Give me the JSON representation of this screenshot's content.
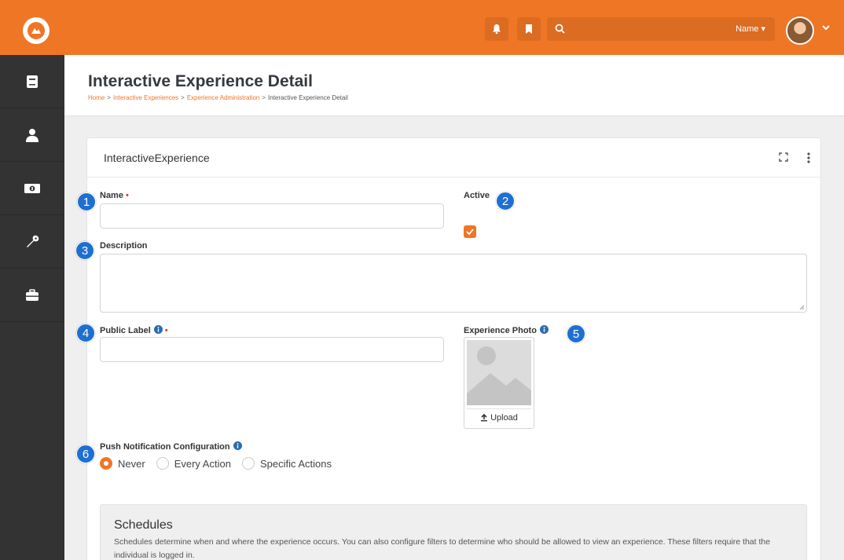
{
  "header": {
    "search_filter": "Name ▾"
  },
  "sidebar": {
    "items": [
      {
        "icon": "book-icon"
      },
      {
        "icon": "person-icon"
      },
      {
        "icon": "money-icon"
      },
      {
        "icon": "wrench-icon"
      },
      {
        "icon": "briefcase-icon"
      }
    ]
  },
  "page": {
    "title": "Interactive Experience Detail",
    "breadcrumb": [
      "Home",
      "Interactive Experiences",
      "Experience Administration",
      "Interactive Experience Detail"
    ]
  },
  "panel": {
    "title": "InteractiveExperience"
  },
  "form": {
    "name_label": "Name",
    "active_label": "Active",
    "active_checked": true,
    "description_label": "Description",
    "public_label_label": "Public Label",
    "photo_label": "Experience Photo",
    "upload_label": "Upload",
    "push_label": "Push Notification Configuration",
    "push_options": [
      "Never",
      "Every Action",
      "Specific Actions"
    ],
    "push_selected": "Never"
  },
  "schedules": {
    "title": "Schedules",
    "description": "Schedules determine when and where the experience occurs. You can also configure filters to determine who should be allowed to view an experience. These filters require that the individual is logged in."
  },
  "callouts": [
    "1",
    "2",
    "3",
    "4",
    "5",
    "6"
  ],
  "colors": {
    "accent": "#ee7625",
    "sidebar": "#333333",
    "callout": "#1f6fd1",
    "required": "#e53935"
  }
}
